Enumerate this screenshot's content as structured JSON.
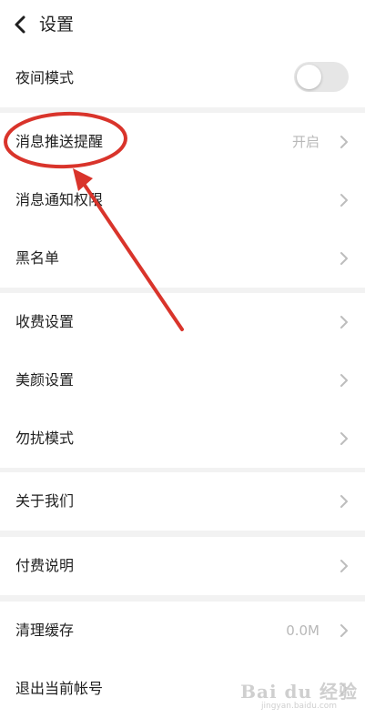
{
  "header": {
    "title": "设置",
    "back_icon": "chevron-left-icon"
  },
  "sections": [
    [
      {
        "name": "night-mode",
        "label": "夜间模式",
        "toggle": {
          "state": "off",
          "color": "#e6e6e6"
        }
      }
    ],
    [
      {
        "name": "push-reminder",
        "label": "消息推送提醒",
        "value": "开启"
      },
      {
        "name": "notification-permission",
        "label": "消息通知权限"
      },
      {
        "name": "blacklist",
        "label": "黑名单"
      }
    ],
    [
      {
        "name": "charge-settings",
        "label": "收费设置"
      },
      {
        "name": "beauty-settings",
        "label": "美颜设置"
      },
      {
        "name": "do-not-disturb",
        "label": "勿扰模式"
      }
    ],
    [
      {
        "name": "about-us",
        "label": "关于我们"
      }
    ],
    [
      {
        "name": "payment-info",
        "label": "付费说明"
      }
    ],
    [
      {
        "name": "clear-cache",
        "label": "清理缓存",
        "value": "0.0M"
      },
      {
        "name": "logout",
        "label": "退出当前帐号"
      }
    ]
  ],
  "annotation": {
    "color": "#d9342b",
    "shape": "circle-and-arrow",
    "target": "push-reminder"
  },
  "watermark": {
    "main": "Bai du 经验",
    "sub": "jingyan.baidu.com"
  }
}
